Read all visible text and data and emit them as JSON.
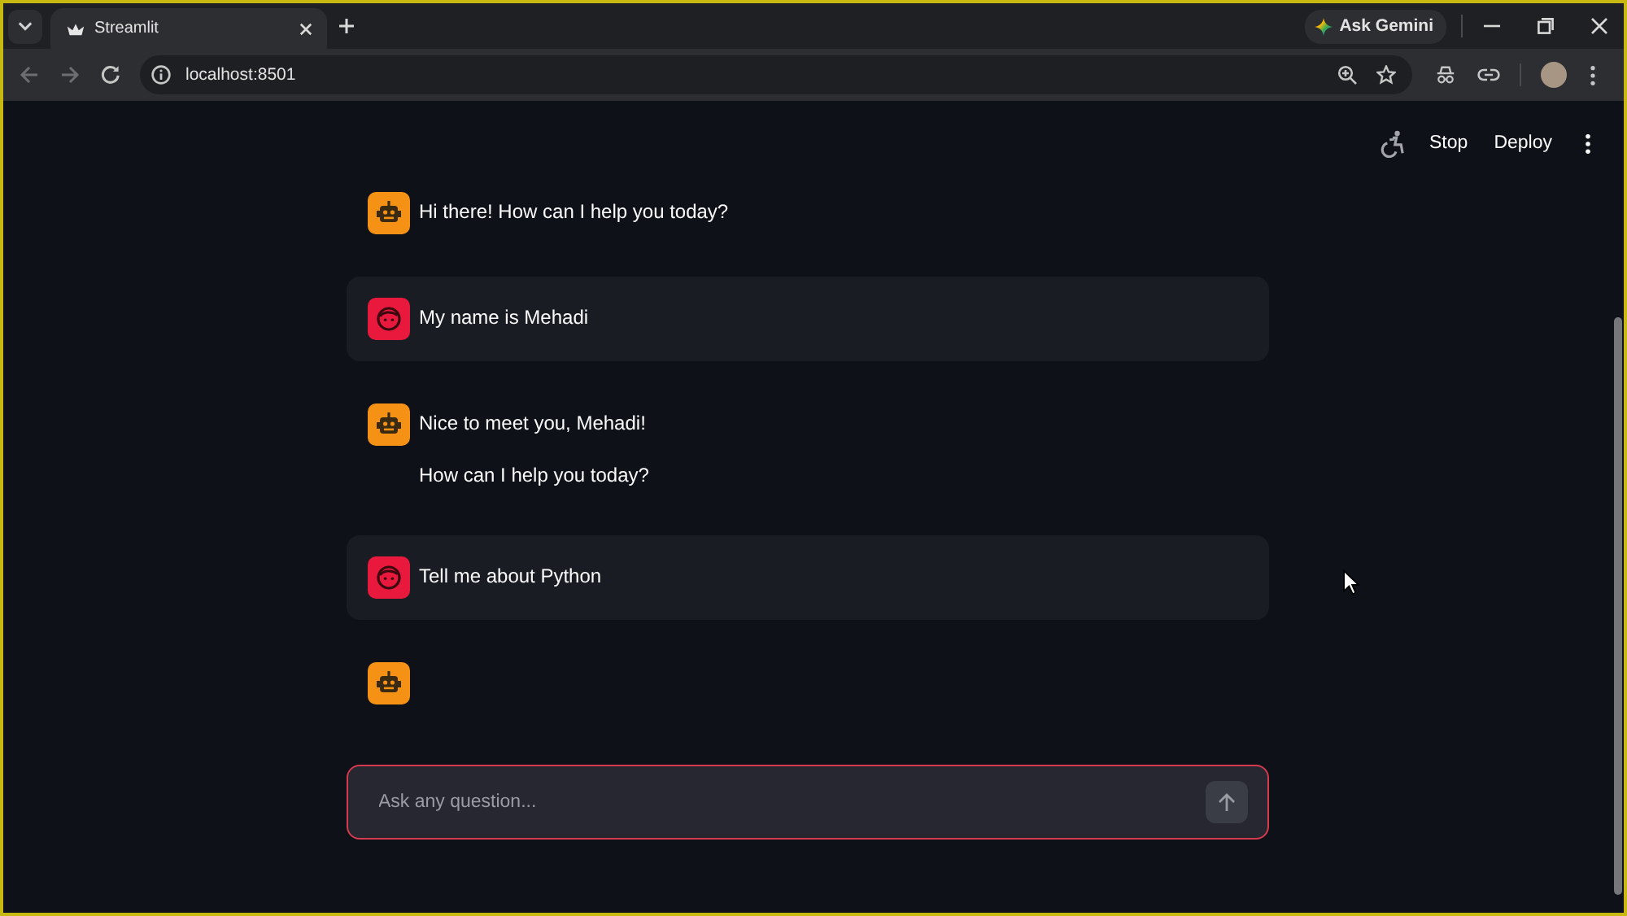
{
  "browser": {
    "tabs": [
      {
        "title": "Streamlit",
        "selected": true
      }
    ],
    "gemini_button": "Ask Gemini",
    "nav_buttons": [
      {
        "kind": "back",
        "disabled": true
      },
      {
        "kind": "forward",
        "disabled": true
      },
      {
        "kind": "reload",
        "disabled": false
      }
    ],
    "address": "localhost:8501"
  },
  "app_toolbar": {
    "buttons": [
      "Stop",
      "Deploy"
    ]
  },
  "messages": [
    {
      "kind": "assistant",
      "paragraphs": [
        "Hi there! How can I help you today?"
      ]
    },
    {
      "kind": "user",
      "paragraphs": [
        "My name is Mehadi"
      ]
    },
    {
      "kind": "assistant",
      "paragraphs": [
        "Nice to meet you, Mehadi!",
        "How can I help you today?"
      ]
    },
    {
      "kind": "user",
      "paragraphs": [
        "Tell me about Python"
      ]
    },
    {
      "kind": "assistant"
    }
  ],
  "chat_input": {
    "placeholder": "Ask any question...",
    "focused": true
  }
}
